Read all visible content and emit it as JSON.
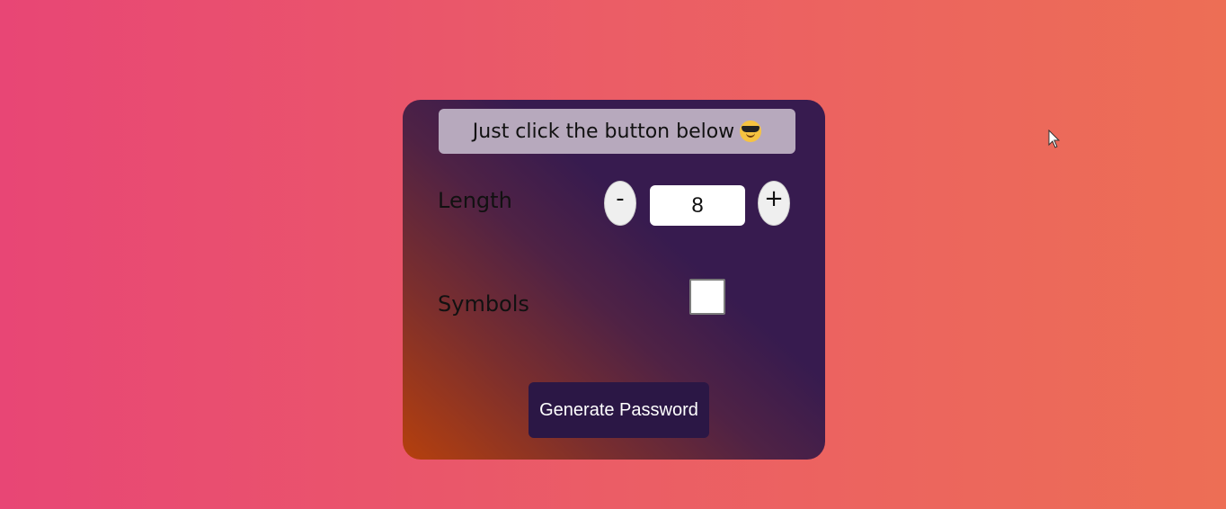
{
  "banner": {
    "text": "Just click the button below",
    "emoji_icon": "smiling-face-with-sunglasses-icon"
  },
  "length": {
    "label": "Length",
    "decrement_label": "-",
    "increment_label": "+",
    "value": "8"
  },
  "symbols": {
    "label": "Symbols",
    "checked": false
  },
  "generate_button": {
    "label": "Generate Password"
  },
  "colors": {
    "background_left": "#e84675",
    "background_right": "#ed6e55",
    "card_dark": "#371b4f",
    "card_accent": "#b6400d",
    "banner_bg": "#b7a9bd",
    "button_bg": "#2b1745"
  }
}
